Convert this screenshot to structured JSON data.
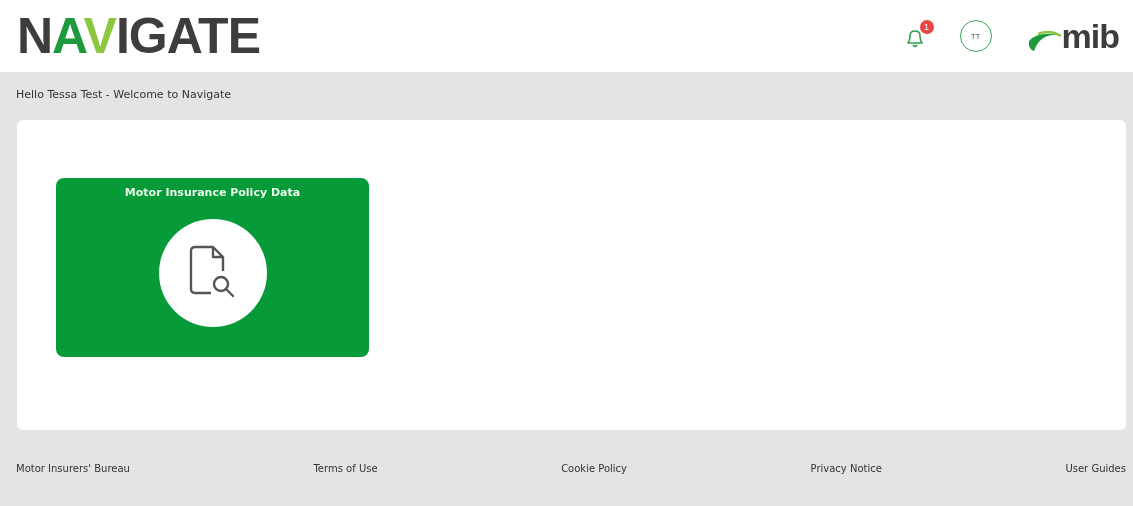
{
  "header": {
    "logo": "NAVIGATE",
    "notifications": {
      "count": "1"
    },
    "avatar": {
      "initials": "TT"
    },
    "brand": "mib"
  },
  "greeting": "Hello Tessa Test - Welcome to Navigate",
  "tiles": [
    {
      "title": "Motor Insurance Policy Data"
    }
  ],
  "footer": {
    "links": [
      "Motor Insurers' Bureau",
      "Terms of Use",
      "Cookie Policy",
      "Privacy Notice",
      "User Guides"
    ]
  }
}
